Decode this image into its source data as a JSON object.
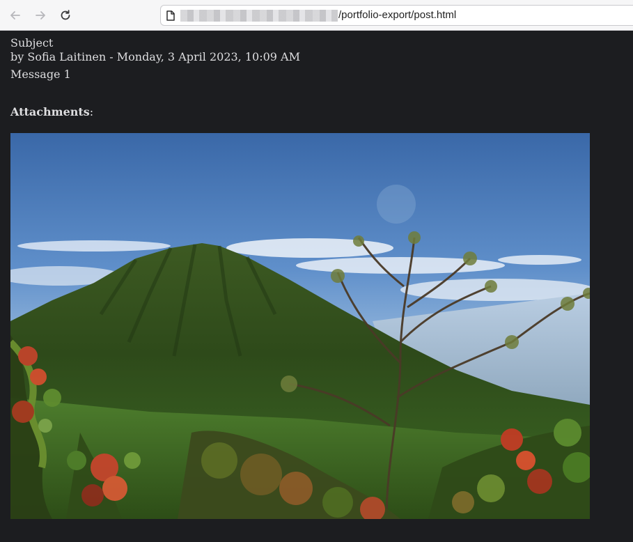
{
  "browser": {
    "url_suffix": "/portfolio-export/post.html",
    "back_icon": "arrow-left-icon",
    "forward_icon": "arrow-right-icon",
    "reload_icon": "reload-icon",
    "page_icon": "document-icon"
  },
  "post": {
    "subject": "Subject",
    "byline": "by Sofia Laitinen - Monday, 3 April 2023, 10:09 AM",
    "message": "Message 1",
    "attachments_label": "Attachments",
    "attachments_colon": ":"
  },
  "colors": {
    "page_background": "#1c1d20",
    "text": "#dedee0",
    "toolbar": "#f6f6f7"
  }
}
